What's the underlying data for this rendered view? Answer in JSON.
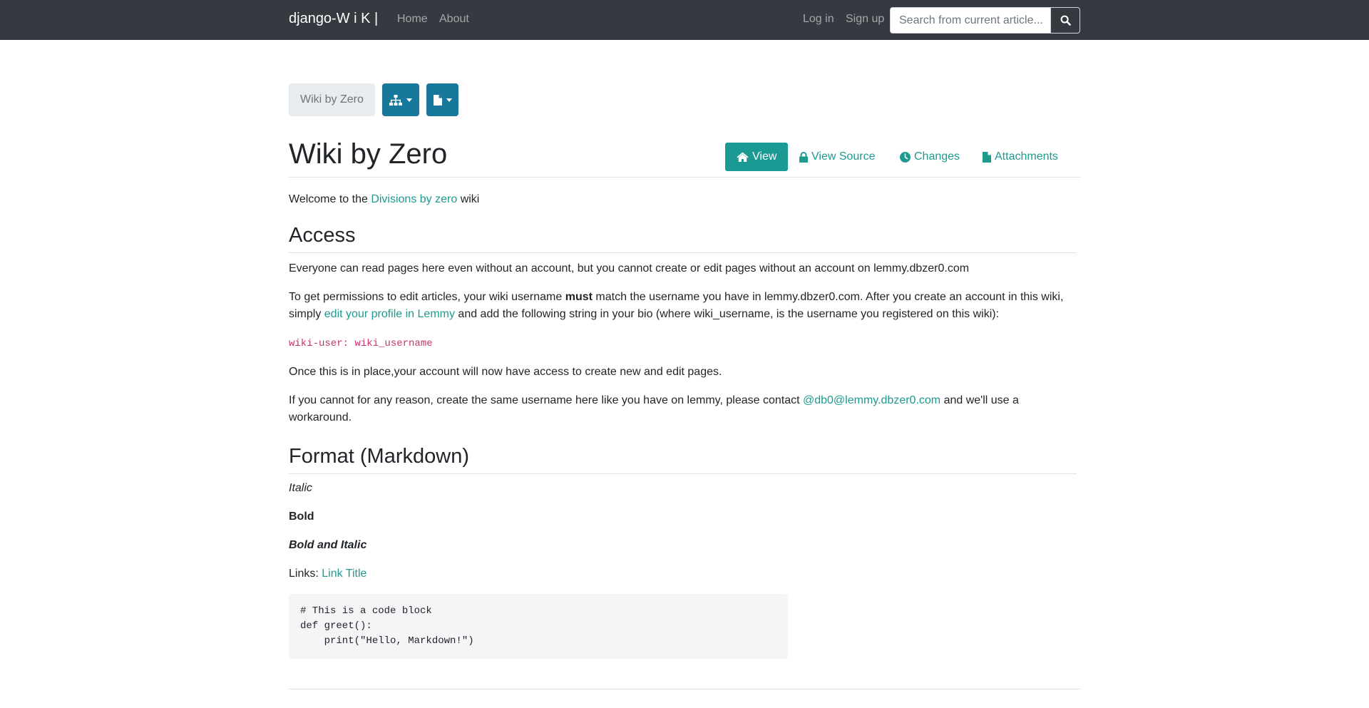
{
  "navbar": {
    "brand": "django-W i K |",
    "home": "Home",
    "about": "About",
    "login": "Log in",
    "signup": "Sign up",
    "search_placeholder": "Search from current article..."
  },
  "toolbar": {
    "breadcrumb": "Wiki by Zero"
  },
  "page": {
    "title": "Wiki by Zero",
    "tabs": {
      "view": "View",
      "view_source": "View Source",
      "changes": "Changes",
      "attachments": "Attachments"
    }
  },
  "article": {
    "intro_before": "Welcome to the ",
    "intro_link": "Divisions by zero",
    "intro_after": " wiki",
    "access_heading": "Access",
    "access_p1": "Everyone can read pages here even without an account, but you cannot create or edit pages without an account on lemmy.dbzer0.com",
    "access_p2_a": "To get permissions to edit articles, your wiki username ",
    "access_p2_bold": "must",
    "access_p2_b": " match the username you have in lemmy.dbzer0.com. After you create an account in this wiki, simply ",
    "access_p2_link": "edit your profile in Lemmy",
    "access_p2_c": " and add the following string in your bio (where wiki_username, is the username you registered on this wiki):",
    "code_inline": "wiki-user: wiki_username",
    "access_p3": "Once this is in place,your account will now have access to create new and edit pages.",
    "access_p4_a": "If you cannot for any reason, create the same username here like you have on lemmy, please contact ",
    "access_p4_link": "@db0@lemmy.dbzer0.com",
    "access_p4_b": " and we'll use a workaround.",
    "format_heading": "Format (Markdown)",
    "italic": "Italic",
    "bold": "Bold",
    "bold_italic": "Bold and Italic",
    "links_label": "Links: ",
    "links_link": "Link Title",
    "code_block": "# This is a code block\ndef greet():\n    print(\"Hello, Markdown!\")"
  },
  "colors": {
    "navbar": "#343a40",
    "accent": "#1a9a92",
    "tool_button": "#17789b"
  }
}
